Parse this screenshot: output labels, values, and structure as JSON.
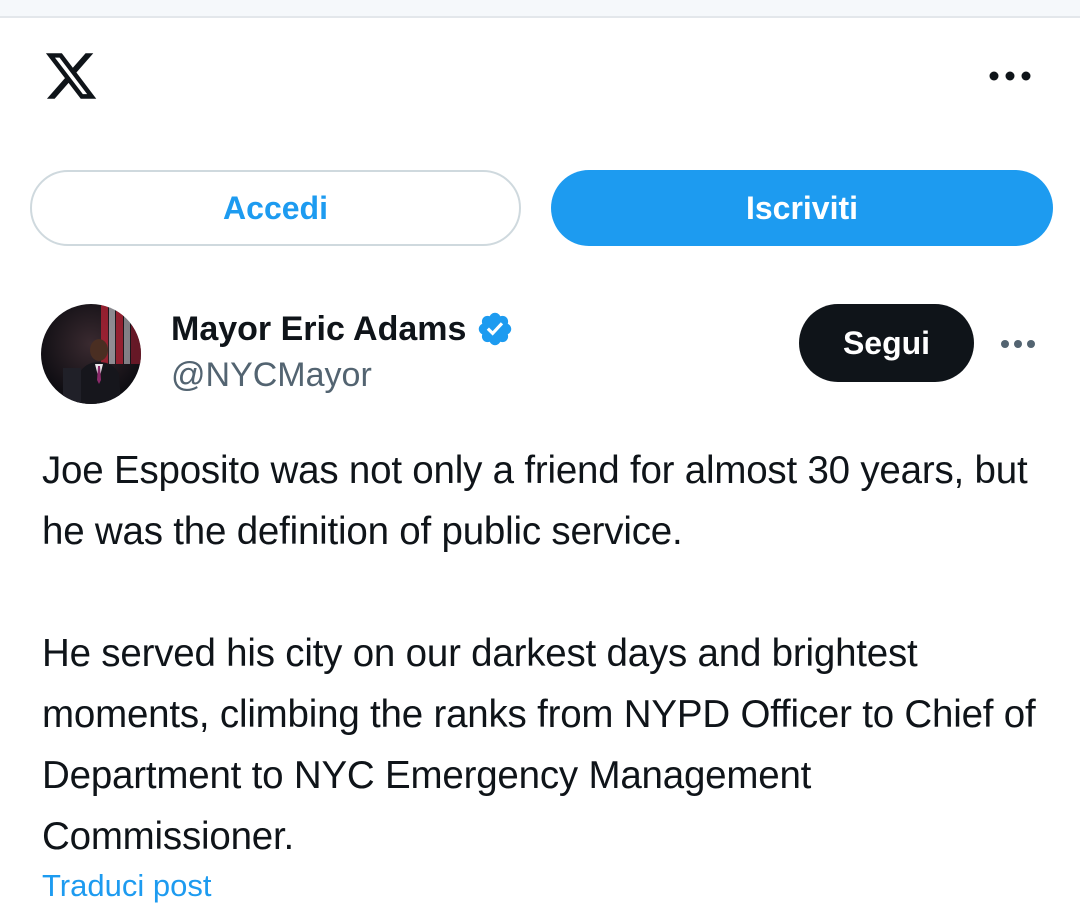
{
  "header": {
    "logo_icon": "x-logo-icon",
    "more_icon": "more-horizontal-icon"
  },
  "auth": {
    "login_label": "Accedi",
    "signup_label": "Iscriviti"
  },
  "post": {
    "author_name": "Mayor Eric Adams",
    "verified_icon": "verified-badge-icon",
    "handle": "@NYCMayor",
    "follow_label": "Segui",
    "more_icon": "more-horizontal-icon",
    "paragraphs": [
      "Joe Esposito was not only a friend for almost 30 years, but he was the definition of public service.",
      "He served his city on our darkest days and brightest moments, climbing the ranks from NYPD Officer to Chief of Department to NYC Emergency Management Commissioner."
    ],
    "translate_label": "Traduci post"
  },
  "colors": {
    "accent": "#1d9bf0",
    "text": "#0f1419",
    "secondary_text": "#536471",
    "follow_bg": "#0f1419"
  }
}
